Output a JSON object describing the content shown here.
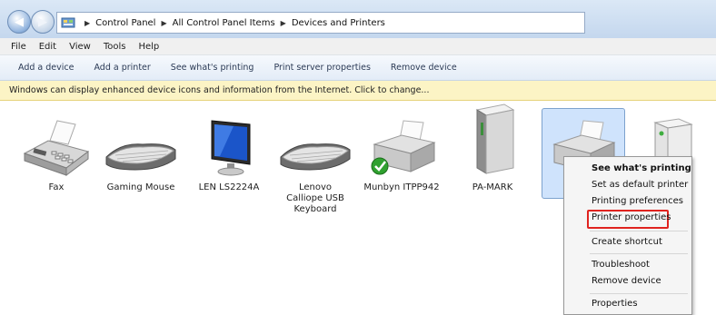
{
  "addressbar": {
    "breadcrumbs": [
      "Control Panel",
      "All Control Panel Items",
      "Devices and Printers"
    ]
  },
  "menubar": {
    "items": [
      "File",
      "Edit",
      "View",
      "Tools",
      "Help"
    ]
  },
  "toolbar": {
    "items": [
      "Add a device",
      "Add a printer",
      "See what's printing",
      "Print server properties",
      "Remove device"
    ]
  },
  "infobar": {
    "text": "Windows can display enhanced device icons and information from the Internet. Click to change..."
  },
  "devices": [
    {
      "label": "Fax",
      "icon": "fax-icon"
    },
    {
      "label": "Gaming Mouse",
      "icon": "keyboard-icon"
    },
    {
      "label": "LEN LS2224A",
      "icon": "monitor-icon"
    },
    {
      "label": "Lenovo Calliope USB Keyboard",
      "icon": "keyboard-icon"
    },
    {
      "label": "Munbyn ITPP942",
      "icon": "printer-icon",
      "default": true
    },
    {
      "label": "PA-MARK",
      "icon": "tower-icon"
    },
    {
      "label": "",
      "icon": "printer-icon",
      "selected": true
    },
    {
      "label": "",
      "icon": "pc-tower-icon"
    }
  ],
  "context_menu": {
    "items": [
      {
        "label": "See what's printing",
        "bold": true
      },
      {
        "label": "Set as default printer"
      },
      {
        "label": "Printing preferences"
      },
      {
        "label": "Printer properties",
        "highlighted": true
      },
      {
        "label": "Create shortcut"
      },
      {
        "label": "Troubleshoot"
      },
      {
        "label": "Remove device"
      },
      {
        "label": "Properties"
      }
    ]
  },
  "colors": {
    "highlight_box": "#e0231f",
    "selection": "#cfe3fc",
    "infobar": "#fcf4c5"
  }
}
